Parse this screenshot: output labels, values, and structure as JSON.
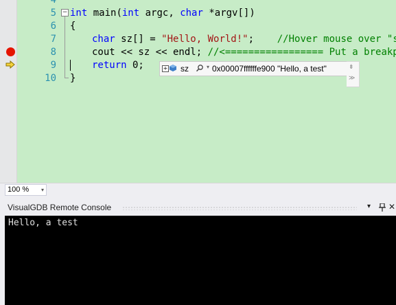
{
  "editor": {
    "lines": [
      {
        "num": "4"
      },
      {
        "num": "5",
        "t1": "int",
        "t2": " main(",
        "t3": "int",
        "t4": " argc, ",
        "t5": "char",
        "t6": " *argv[])"
      },
      {
        "num": "6",
        "text": "{"
      },
      {
        "num": "7",
        "t1": "char",
        "t2": " sz[] = ",
        "t3": "\"Hello, World!\"",
        "t4": ";    ",
        "t5": "//Hover mouse over \"sz\""
      },
      {
        "num": "8",
        "t1": "cout << sz << endl; ",
        "t2": "//<================= Put a breakpoint"
      },
      {
        "num": "9",
        "t1": "return",
        "t2": " 0;"
      },
      {
        "num": "10",
        "text": "}"
      }
    ],
    "collapse_glyph": "⊟",
    "expand_glyph": "+"
  },
  "datatip": {
    "var_name": "sz",
    "value": "0x00007ffffffe900 \"Hello, a test\"",
    "drop_glyph": "▾"
  },
  "pins": {
    "top": "⇟",
    "bottom": "≫"
  },
  "zoom": {
    "value": "100 %",
    "arrow": "▾"
  },
  "console": {
    "title": "VisualGDB Remote Console",
    "btn_dropdown": "▾",
    "btn_pin": "📌",
    "btn_close": "✕",
    "output": "Hello, a test"
  },
  "colors": {
    "breakpoint": "#e51400",
    "arrow": "#f5d33c",
    "code_bg": "#c7ecc7",
    "keyword": "#0000ff",
    "string": "#a31515",
    "comment": "#008000"
  }
}
